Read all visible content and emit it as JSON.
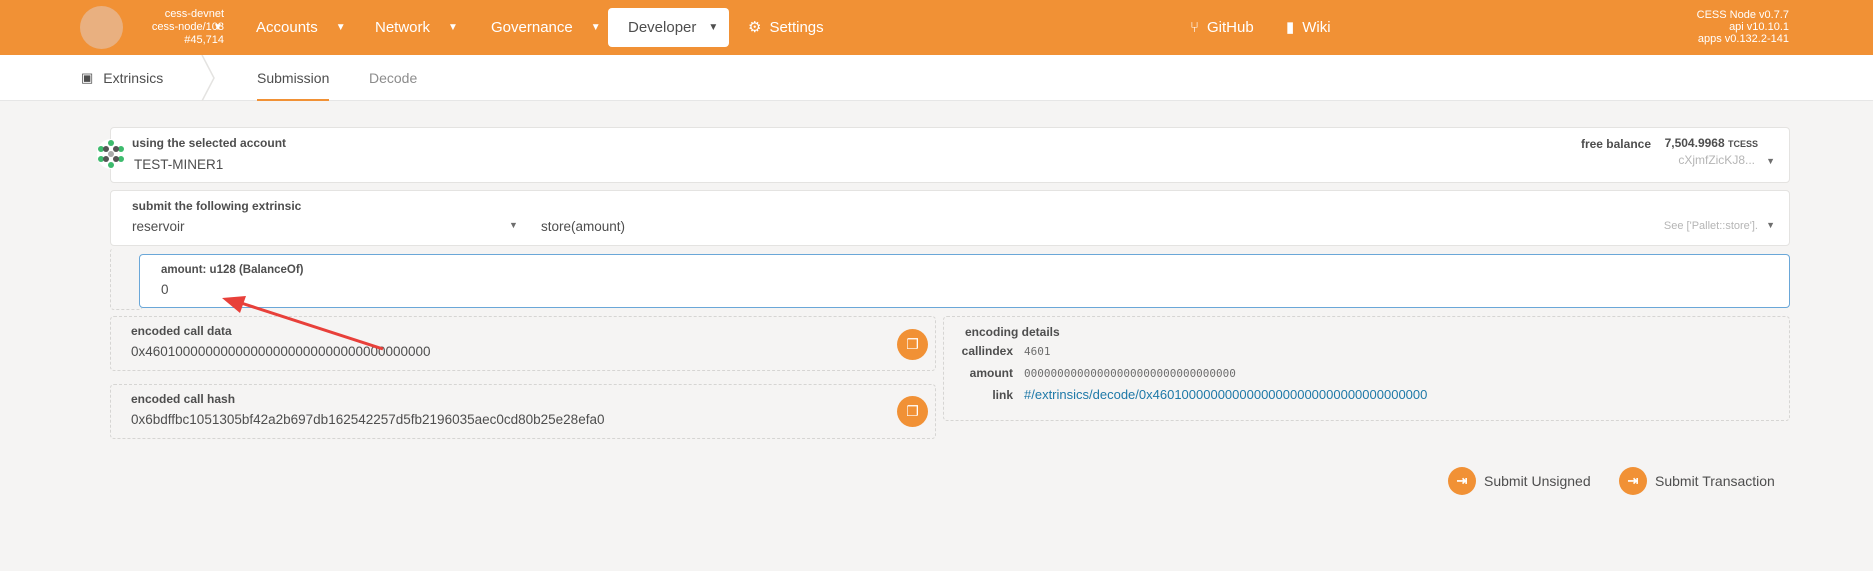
{
  "chain": {
    "name": "cess-devnet",
    "node": "cess-node/103",
    "block": "#45,714"
  },
  "nav": {
    "accounts": "Accounts",
    "network": "Network",
    "governance": "Governance",
    "developer": "Developer",
    "settings": "Settings",
    "github": "GitHub",
    "wiki": "Wiki"
  },
  "version": {
    "node": "CESS Node v0.7.7",
    "api": "api v10.10.1",
    "apps": "apps v0.132.2-141"
  },
  "subnav": {
    "section": "Extrinsics",
    "tabs": [
      "Submission",
      "Decode"
    ]
  },
  "account": {
    "label": "using the selected account",
    "name": "TEST-MINER1",
    "balance_label": "free balance",
    "balance": "7,504.9968",
    "unit": "TCESS",
    "address": "cXjmfZicKJ8..."
  },
  "extrinsic": {
    "label": "submit the following extrinsic",
    "pallet": "reservoir",
    "method": "store(amount)",
    "doc": "See ['Pallet::store']."
  },
  "param": {
    "label": "amount: u128 (BalanceOf)",
    "value": "0"
  },
  "call_data": {
    "label": "encoded call data",
    "value": "0x46010000000000000000000000000000000000"
  },
  "call_hash": {
    "label": "encoded call hash",
    "value": "0x6bdffbc1051305bf42a2b697db162542257d5fb2196035aec0cd80b25e28efa0"
  },
  "encoding": {
    "label": "encoding details",
    "callindex_key": "callindex",
    "callindex": "4601",
    "amount_key": "amount",
    "amount": "00000000000000000000000000000000",
    "link_key": "link",
    "link": "#/extrinsics/decode/0x46010000000000000000000000000000000000"
  },
  "actions": {
    "unsigned": "Submit Unsigned",
    "transaction": "Submit Transaction"
  },
  "colors": {
    "brand": "#f19135",
    "link": "#1e79a8",
    "arrow": "#e8403a"
  },
  "icons": [
    "chain-logo-icon",
    "caret-down-icon",
    "gear-icon",
    "github-icon",
    "book-icon",
    "extrinsics-icon",
    "identicon",
    "copy-icon",
    "sign-in-icon"
  ]
}
